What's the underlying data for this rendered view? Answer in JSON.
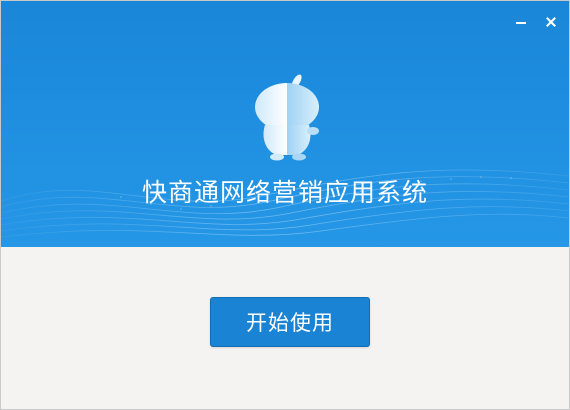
{
  "window": {
    "minimize_icon": "minimize-icon",
    "close_icon": "close-icon"
  },
  "banner": {
    "app_title": "快商通网络营销应用系统",
    "mascot_icon": "mascot-logo-icon"
  },
  "actions": {
    "start_label": "开始使用"
  },
  "colors": {
    "banner_blue": "#1f8ee0",
    "button_blue": "#1a83d4",
    "body_background": "#f5f2f2"
  }
}
